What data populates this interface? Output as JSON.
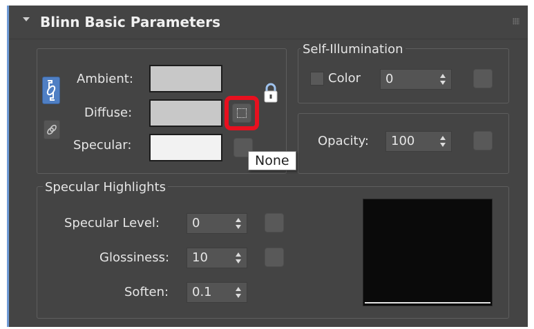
{
  "rollout": {
    "title": "Blinn Basic Parameters"
  },
  "colors": {
    "ambient_swatch": "#c8c8c8",
    "diffuse_swatch": "#c8c8c8",
    "specular_swatch": "#f2f2f2",
    "highlight_ring": "#e8101f",
    "lock_button_active": "#4f7fc4",
    "preview_background": "#0a0a0a"
  },
  "basic_colors": {
    "ambient_label": "Ambient:",
    "diffuse_label": "Diffuse:",
    "specular_label": "Specular:"
  },
  "self_illumination": {
    "group_label": "Self-Illumination",
    "color_label": "Color",
    "value": "0"
  },
  "opacity": {
    "label": "Opacity:",
    "value": "100"
  },
  "tooltip": {
    "text": "None"
  },
  "specular_highlights": {
    "group_label": "Specular Highlights",
    "specular_level_label": "Specular Level:",
    "specular_level_value": "0",
    "glossiness_label": "Glossiness:",
    "glossiness_value": "10",
    "soften_label": "Soften:",
    "soften_value": "0.1"
  },
  "icons": {
    "collapse": "chevron-down-icon",
    "grip": "grip-icon",
    "lock_ambient_diffuse": "link-icon",
    "lock_diffuse_specular": "link-icon",
    "lock_map": "padlock-icon"
  }
}
